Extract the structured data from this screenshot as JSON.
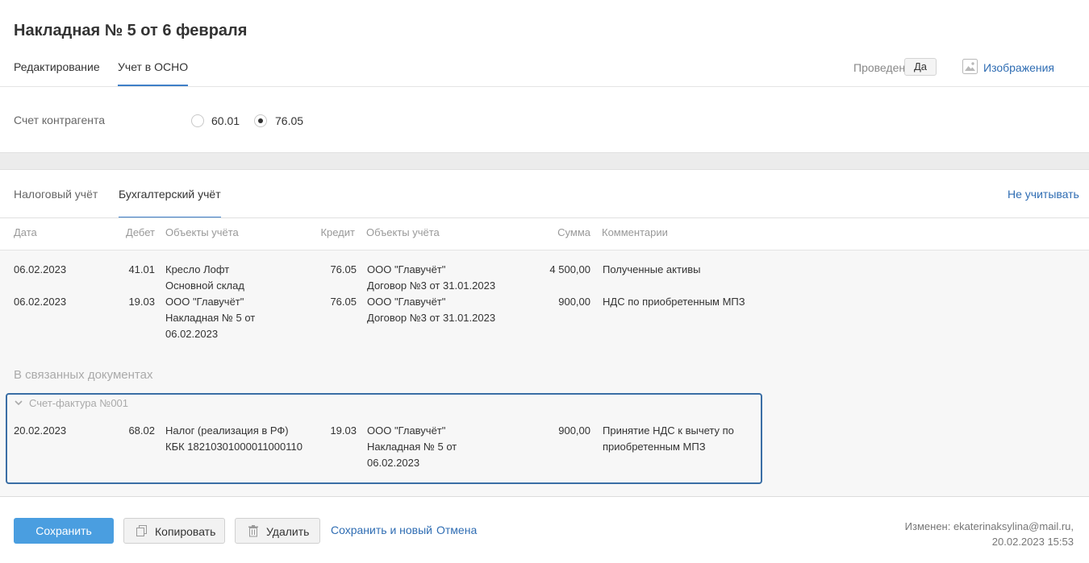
{
  "header": {
    "title": "Накладная № 5 от 6 февраля",
    "tabs": [
      "Редактирование",
      "Учет в ОСНО"
    ],
    "posted_label": "Проведен",
    "posted_value": "Да",
    "images_label": "Изображения"
  },
  "counterparty": {
    "label": "Счет контрагента",
    "options": [
      "60.01",
      "76.05"
    ],
    "selected": "76.05"
  },
  "subtabs": {
    "items": [
      "Налоговый учёт",
      "Бухгалтерский учёт"
    ],
    "active": "Бухгалтерский учёт",
    "ignore_link": "Не учитывать"
  },
  "table": {
    "columns": [
      "Дата",
      "Дебет",
      "Объекты учёта",
      "Кредит",
      "Объекты учёта",
      "Сумма",
      "Комментарии"
    ],
    "rows": [
      {
        "date": "06.02.2023",
        "debit": "41.01",
        "debit_objects": [
          "Кресло Лофт",
          "Основной склад"
        ],
        "credit": "76.05",
        "credit_objects": [
          "ООО \"Главучёт\"",
          "Договор №3 от 31.01.2023"
        ],
        "sum": "4 500,00",
        "comment": [
          "Полученные активы"
        ]
      },
      {
        "date": "06.02.2023",
        "debit": "19.03",
        "debit_objects": [
          "ООО \"Главучёт\"",
          "Накладная № 5 от",
          "06.02.2023"
        ],
        "credit": "76.05",
        "credit_objects": [
          "ООО \"Главучёт\"",
          "Договор №3 от 31.01.2023"
        ],
        "sum": "900,00",
        "comment": [
          "НДС по приобретенным МПЗ"
        ]
      }
    ]
  },
  "linked": {
    "title": "В связанных документах",
    "invoice_title": "Счет-фактура №001",
    "rows": [
      {
        "date": "20.02.2023",
        "debit": "68.02",
        "debit_objects": [
          "Налог (реализация в РФ)",
          "КБК 18210301000011000110"
        ],
        "credit": "19.03",
        "credit_objects": [
          "ООО \"Главучёт\"",
          "Накладная № 5 от",
          "06.02.2023"
        ],
        "sum": "900,00",
        "comment": [
          "Принятие НДС к вычету по",
          "приобретенным МПЗ"
        ]
      }
    ]
  },
  "footer": {
    "save": "Сохранить",
    "copy": "Копировать",
    "delete": "Удалить",
    "save_new": "Сохранить и новый",
    "cancel": "Отмена",
    "modified_line1": "Изменен: ekaterinaksylina@mail.ru,",
    "modified_line2": "20.02.2023 15:53"
  },
  "colors": {
    "accent": "#3f7fc8",
    "link": "#2f6db3",
    "primary_button": "#4a9ee0",
    "linked_border": "#3a6ea5"
  }
}
